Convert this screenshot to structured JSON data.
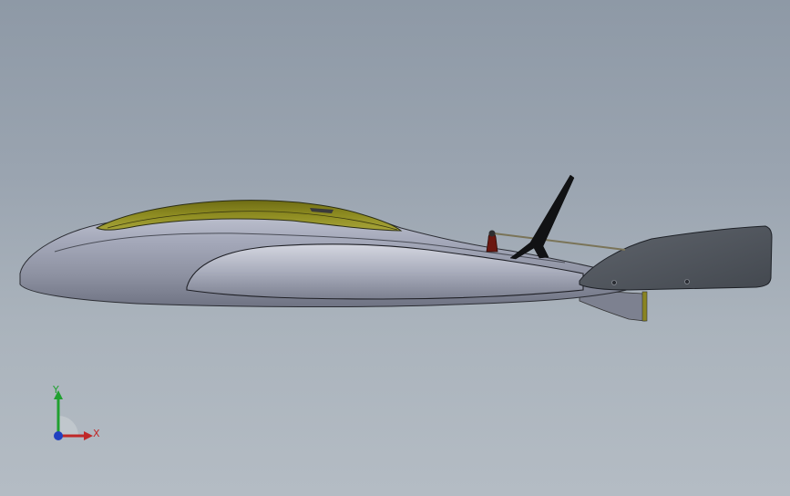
{
  "viewport": {
    "background_top": "#8e99a6",
    "background_bottom": "#b4bcc4"
  },
  "model": {
    "body_color": "#a3a7b6",
    "canopy_color": "#8c8a1e",
    "tail_color": "#50555d",
    "mast_color": "#111111",
    "fitting_color": "#8a1a12"
  },
  "triad": {
    "x_label": "X",
    "y_label": "Y",
    "x_color": "#c02828",
    "y_color": "#20a030",
    "z_color": "#2040c0"
  }
}
